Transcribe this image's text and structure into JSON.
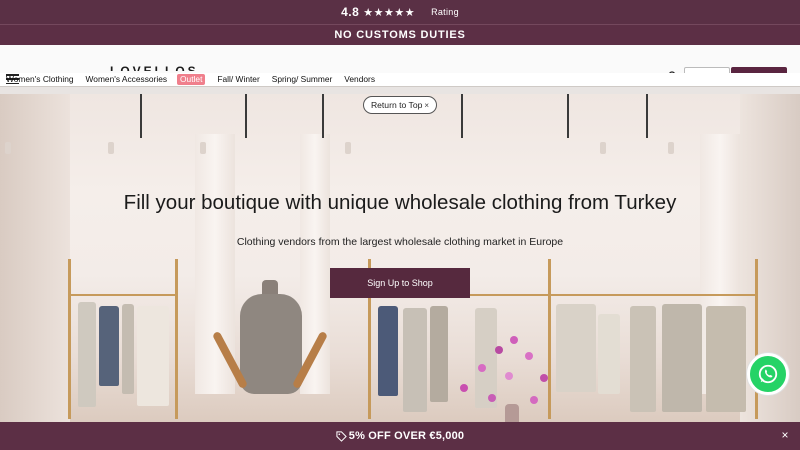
{
  "rating_bar": {
    "score": "4.8",
    "stars": "★★★★★",
    "label": "Rating"
  },
  "customs_bar": {
    "text": "NO CUSTOMS DUTIES"
  },
  "header": {
    "logo_text": "LOVELLOS"
  },
  "nav": {
    "items": [
      {
        "label": "Women's Clothing"
      },
      {
        "label": "Women's Accessories"
      },
      {
        "label": "Outlet"
      },
      {
        "label": "Fall/ Winter"
      },
      {
        "label": "Spring/ Summer"
      },
      {
        "label": "Vendors"
      }
    ]
  },
  "return_to_top": {
    "label": "Return to Top",
    "close": "×"
  },
  "hero": {
    "title": "Fill your boutique with unique wholesale clothing from Turkey",
    "subtitle": "Clothing vendors from the largest wholesale clothing market in Europe",
    "cta_label": "Sign Up to Shop"
  },
  "promo_bar": {
    "text": "5% OFF OVER €5,000",
    "close": "×"
  },
  "icons": {
    "whatsapp": "whatsapp-icon",
    "tag": "tag-icon",
    "menu": "hamburger-icon",
    "search": "search-icon"
  },
  "colors": {
    "brand": "#5c2f45",
    "outlet": "#f07f8c",
    "whatsapp": "#25d366"
  }
}
